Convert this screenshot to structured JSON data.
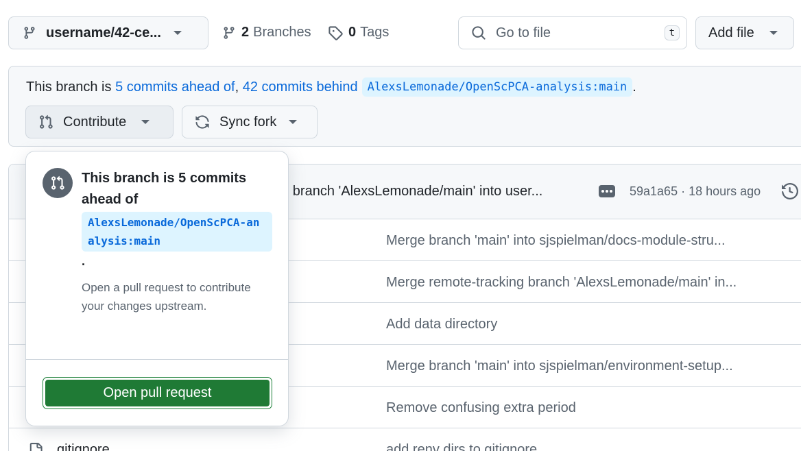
{
  "toolbar": {
    "branch_name": "username/42-ce...",
    "branches_count": "2",
    "branches_label": "Branches",
    "tags_count": "0",
    "tags_label": "Tags",
    "goto_placeholder": "Go to file",
    "goto_shortcut": "t",
    "add_file_label": "Add file"
  },
  "fork_banner": {
    "prefix": "This branch is",
    "ahead_link": "5 commits ahead of",
    "comma": ",",
    "behind_link": "42 commits behind",
    "upstream": "AlexsLemonade/OpenScPCA-analysis:main",
    "suffix": ".",
    "contribute_label": "Contribute",
    "sync_label": "Sync fork"
  },
  "latest_commit": {
    "message": "ng branch 'AlexsLemonade/main' into user...",
    "meta": "59a1a65 · 18 hours ago"
  },
  "file_rows": [
    {
      "name": "",
      "message": "Merge branch 'main' into sjspielman/docs-module-stru..."
    },
    {
      "name": "",
      "message": "Merge remote-tracking branch 'AlexsLemonade/main' in..."
    },
    {
      "name": "",
      "message": "Add data directory"
    },
    {
      "name": "",
      "message": "Merge branch 'main' into sjspielman/environment-setup..."
    },
    {
      "name": "",
      "message": "Remove confusing extra period"
    },
    {
      "name": "gitignore",
      "message": "add renv dirs to gitignore"
    }
  ],
  "popover": {
    "title": "This branch is 5 commits ahead of",
    "upstream": "AlexsLemonade/OpenScPCA-analysis:main",
    "period": ".",
    "description": "Open a pull request to contribute your changes upstream.",
    "button_label": "Open pull request"
  },
  "colors": {
    "link": "#0969da",
    "chip_bg": "#ddf4ff",
    "primary_green": "#1f7a35"
  }
}
